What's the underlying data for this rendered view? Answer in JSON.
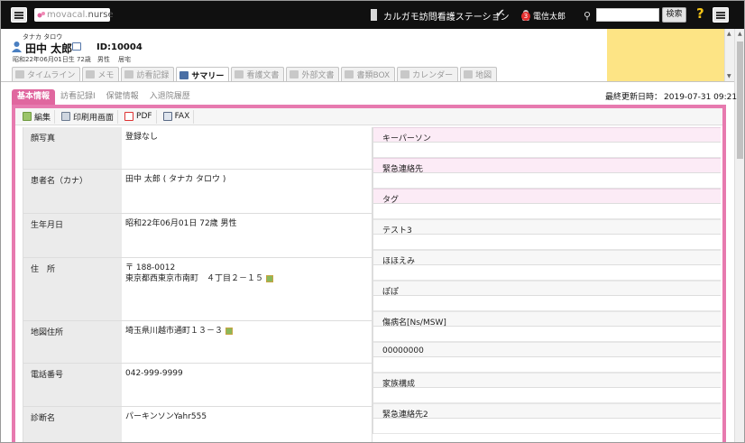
{
  "topbar": {
    "logo_text": "movacal.",
    "logo_suffix": "nurse",
    "station": "カルガモ訪問看護ステーション",
    "notification_count": "3",
    "user_name": "電信太郎",
    "search_placeholder": "",
    "search_button": "検索",
    "help": "?"
  },
  "patient": {
    "kana": "タナカ タロウ",
    "name": "田中 太郎",
    "id": "ID:10004",
    "birth_info": "昭和22年06月01日生 72歳　男性",
    "residence": "居宅"
  },
  "tabs": [
    {
      "label": "タイムライン"
    },
    {
      "label": "メモ"
    },
    {
      "label": "訪看記録"
    },
    {
      "label": "サマリー"
    },
    {
      "label": "看護文書"
    },
    {
      "label": "外部文書"
    },
    {
      "label": "書類BOX"
    },
    {
      "label": "カレンダー"
    },
    {
      "label": "地図"
    }
  ],
  "subtabs": [
    {
      "label": "基本情報"
    },
    {
      "label": "訪看記録I"
    },
    {
      "label": "保健情報"
    },
    {
      "label": "入退院履歴"
    }
  ],
  "last_updated": {
    "label": "最終更新日時：",
    "value": "2019-07-31 09:21"
  },
  "toolbar": {
    "edit": "編集",
    "print": "印刷用画面",
    "pdf": "PDF",
    "fax": "FAX"
  },
  "left_rows": [
    {
      "label": "顔写真",
      "value": "登録なし"
    },
    {
      "label": "患者名（カナ）",
      "value": "田中 太郎 ( タナカ タロウ )"
    },
    {
      "label": "生年月日",
      "value": "昭和22年06月01日 72歳 男性"
    },
    {
      "label": "住　所",
      "value": "〒 188-0012",
      "value2": "東京都西東京市南町　４丁目２－１５"
    },
    {
      "label": "地図住所",
      "value": "埼玉県川越市通町１３－３"
    },
    {
      "label": "電話番号",
      "value": "042-999-9999"
    },
    {
      "label": "診断名",
      "value": "パーキンソンYahr555"
    }
  ],
  "right_rows": [
    {
      "label": "キーパーソン",
      "value": ""
    },
    {
      "label": "緊急連絡先",
      "value": ""
    },
    {
      "label": "タグ",
      "value": ""
    },
    {
      "label": "テスト3",
      "value": ""
    },
    {
      "label": "ほほえみ",
      "value": ""
    },
    {
      "label": "ぽぽ",
      "value": ""
    },
    {
      "label": "傷病名[Ns/MSW]",
      "value": ""
    },
    {
      "label": "00000000",
      "value": ""
    },
    {
      "label": "家族構成",
      "value": ""
    },
    {
      "label": "緊急連絡先2",
      "value": ""
    }
  ],
  "colors": {
    "accent_pink": "#e77aaf",
    "memo_yellow": "#fde485",
    "topbar": "#101010"
  }
}
